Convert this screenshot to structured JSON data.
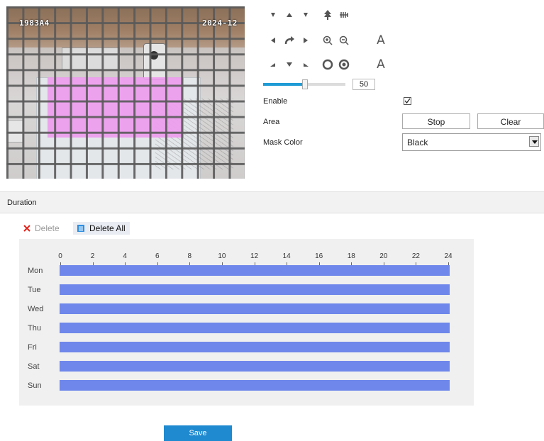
{
  "video": {
    "osd_left": "1983A4",
    "osd_right": "2024-12"
  },
  "ptz": {
    "speed_value": "50",
    "speed_fraction": 0.5,
    "icons": [
      "arrow-up-left",
      "arrow-up",
      "arrow-up-right",
      "wiper",
      "light",
      "arrow-left",
      "rotate",
      "arrow-right",
      "zoom-in",
      "zoom-out",
      "focus-letter",
      "arrow-down-left",
      "arrow-down",
      "arrow-down-right",
      "iris-open",
      "iris-close",
      "focus-letter"
    ],
    "letter_a": "A"
  },
  "form": {
    "enable_label": "Enable",
    "enable_checked": true,
    "area_label": "Area",
    "stop_label": "Stop",
    "clear_label": "Clear",
    "mask_color_label": "Mask Color",
    "mask_color_value": "Black"
  },
  "duration": {
    "title": "Duration",
    "delete_label": "Delete",
    "delete_all_label": "Delete All",
    "hours": [
      "0",
      "2",
      "4",
      "6",
      "8",
      "10",
      "12",
      "14",
      "16",
      "18",
      "20",
      "22",
      "24"
    ],
    "days": [
      "Mon",
      "Tue",
      "Wed",
      "Thu",
      "Fri",
      "Sat",
      "Sun"
    ],
    "bar_color": "#6f87ea"
  },
  "save_label": "Save",
  "colors": {
    "accent": "#1f8ad0",
    "mask": "#ee9cee"
  }
}
